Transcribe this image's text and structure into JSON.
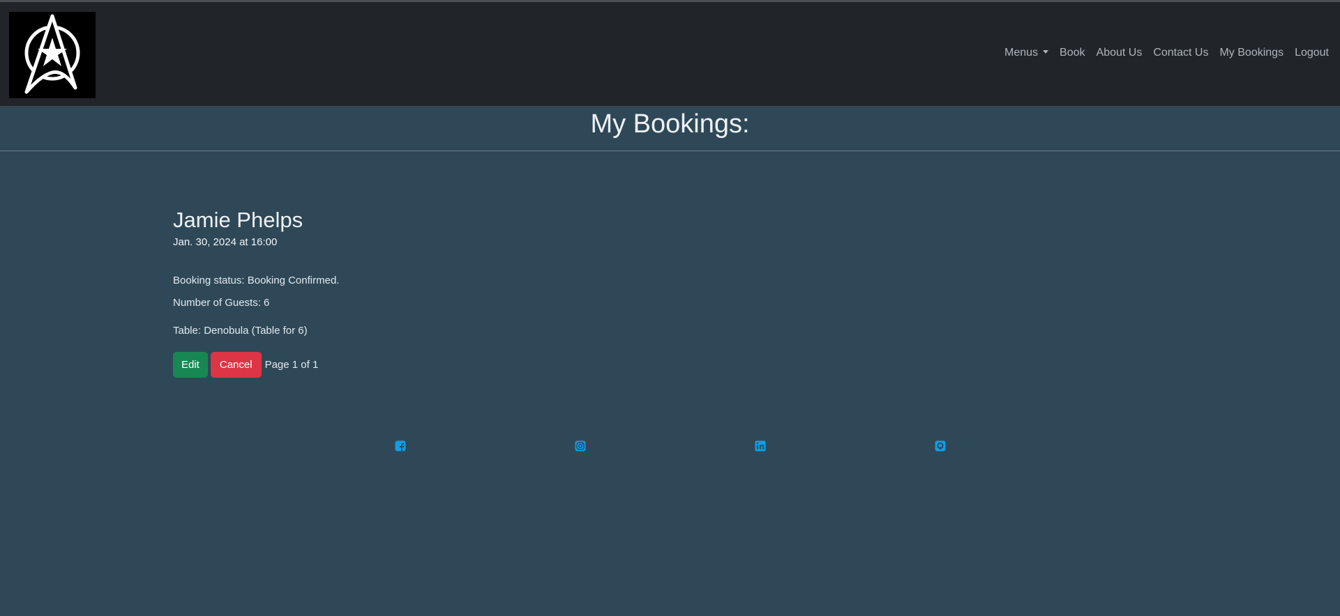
{
  "nav": {
    "items": [
      {
        "label": "Menus",
        "dropdown": true
      },
      {
        "label": "Book"
      },
      {
        "label": "About Us"
      },
      {
        "label": "Contact Us"
      },
      {
        "label": "My Bookings"
      },
      {
        "label": "Logout"
      }
    ]
  },
  "page": {
    "title": "My Bookings:"
  },
  "booking": {
    "name": "Jamie Phelps",
    "datetime": "Jan. 30, 2024 at 16:00",
    "status": "Booking status: Booking Confirmed.",
    "guests": "Number of Guests: 6",
    "table": "Table: Denobula (Table for 6)",
    "edit_label": "Edit",
    "cancel_label": "Cancel",
    "pagination": "Page 1 of 1"
  },
  "footer": {
    "social": [
      "facebook-icon",
      "instagram-icon",
      "linkedin-icon",
      "github-icon"
    ],
    "icon_color": "#0d9ee8"
  },
  "colors": {
    "navbar": "#212529",
    "background": "#2f4858",
    "edit": "#198754",
    "cancel": "#dc3545"
  }
}
